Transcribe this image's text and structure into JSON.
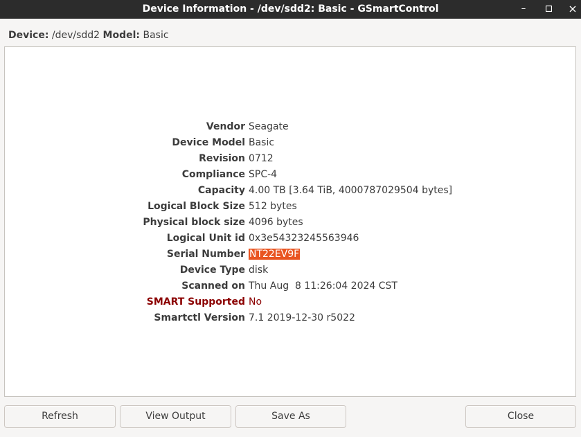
{
  "window": {
    "title": "Device Information - /dev/sdd2: Basic - GSmartControl",
    "minimize_glyph": "–",
    "colors": {
      "titlebar_bg": "#2c2c2c",
      "highlight": "#e95420",
      "warning": "#8b0000"
    }
  },
  "device_line": {
    "device_label": "Device:",
    "device_value": "/dev/sdd2",
    "model_label": "Model:",
    "model_value": "Basic"
  },
  "info": [
    {
      "label": "Vendor",
      "value": "Seagate"
    },
    {
      "label": "Device Model",
      "value": "Basic"
    },
    {
      "label": "Revision",
      "value": "0712"
    },
    {
      "label": "Compliance",
      "value": "SPC-4"
    },
    {
      "label": "Capacity",
      "value": "4.00 TB [3.64 TiB, 4000787029504 bytes]"
    },
    {
      "label": "Logical Block Size",
      "value": "512 bytes"
    },
    {
      "label": "Physical block size",
      "value": "4096 bytes"
    },
    {
      "label": "Logical Unit id",
      "value": "0x3e54323245563946"
    },
    {
      "label": "Serial Number",
      "value": "NT22EV9F"
    },
    {
      "label": "Device Type",
      "value": "disk"
    },
    {
      "label": "Scanned on",
      "value": "Thu Aug  8 11:26:04 2024 CST"
    },
    {
      "label": "SMART Supported",
      "value": "No"
    },
    {
      "label": "Smartctl Version",
      "value": "7.1 2019-12-30 r5022"
    }
  ],
  "buttons": {
    "refresh": "Refresh",
    "view_output": "View Output",
    "save_as": "Save As",
    "close": "Close"
  }
}
